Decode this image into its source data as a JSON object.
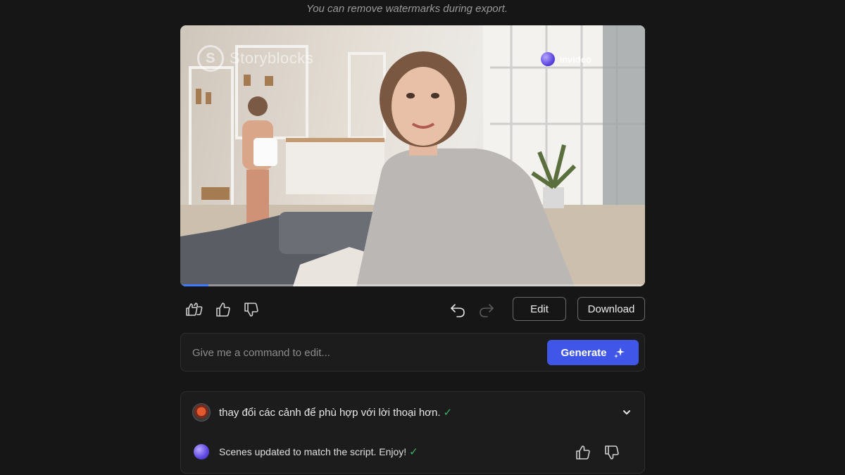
{
  "notice": "You can remove watermarks during export.",
  "video": {
    "watermark_left": "Storyblocks",
    "watermark_left_logo": "S",
    "watermark_right": "invideo",
    "progress": 0.06
  },
  "controls": {
    "edit_label": "Edit",
    "download_label": "Download"
  },
  "command": {
    "placeholder": "Give me a command to edit...",
    "generate_label": "Generate"
  },
  "history": {
    "user_message": "thay đổi các cảnh để phù hợp với lời thoại hơn.",
    "bot_message": "Scenes updated to match the script. Enjoy!",
    "check": "✓"
  },
  "colors": {
    "accent": "#3f56e8",
    "progress": "#3f7bff",
    "success": "#3bb36a"
  }
}
